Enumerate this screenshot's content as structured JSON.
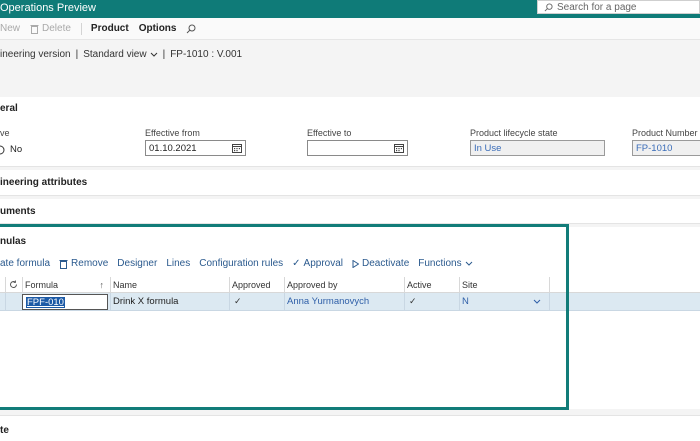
{
  "app": {
    "title": "Operations Preview"
  },
  "search": {
    "placeholder": "Search for a page",
    "icon": "search-icon"
  },
  "actionbar": {
    "new_label": "New",
    "delete_label": "Delete",
    "product_label": "Product",
    "options_label": "Options"
  },
  "breadcrumb": {
    "part1": "ineering version",
    "part2": "Standard view",
    "part3": "FP-1010 : V.001"
  },
  "general": {
    "title": "eral",
    "active_label": "ve",
    "active_value": "No",
    "effective_from_label": "Effective from",
    "effective_from_value": "01.10.2021",
    "effective_to_label": "Effective to",
    "effective_to_value": "",
    "lifecycle_label": "Product lifecycle state",
    "lifecycle_value": "In Use",
    "product_number_label": "Product Number",
    "product_number_value": "FP-1010"
  },
  "sections": {
    "engineering_attributes": "ineering attributes",
    "documents": "uments",
    "formulas": "nulas",
    "bottom": "te"
  },
  "formulas_toolbar": {
    "create_formula": "ate formula",
    "remove": "Remove",
    "designer": "Designer",
    "lines": "Lines",
    "configuration_rules": "Configuration rules",
    "approval": "Approval",
    "deactivate": "Deactivate",
    "functions": "Functions"
  },
  "grid": {
    "headers": {
      "formula": "Formula",
      "name": "Name",
      "approved": "Approved",
      "approved_by": "Approved by",
      "active": "Active",
      "site": "Site"
    },
    "rows": [
      {
        "formula": "FPF-010",
        "name": "Drink X formula",
        "approved": "✓",
        "approved_by": "Anna Yurmanovych",
        "active": "✓",
        "site": "N"
      }
    ]
  },
  "colors": {
    "brand": "#0f7b78",
    "highlight": "#127c79",
    "selected_row": "#dce9f2",
    "link": "#2f5fa8"
  }
}
